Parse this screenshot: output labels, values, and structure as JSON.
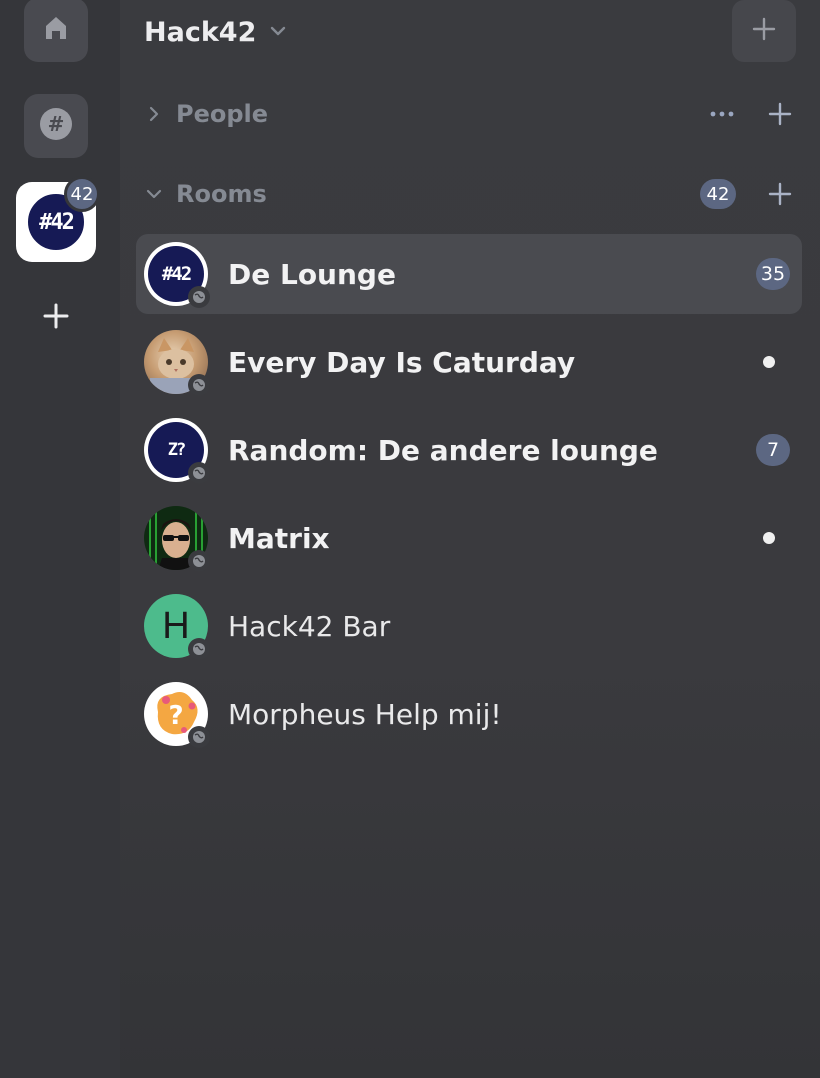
{
  "rail": {
    "home_icon": "home-icon",
    "explore_icon": "hash-icon",
    "active_space": {
      "name": "Hack42",
      "badge": "42",
      "avatar_text": "#42"
    },
    "add_icon": "plus-icon"
  },
  "header": {
    "space_name": "Hack42",
    "chevron": "chevron-down-icon",
    "add_icon": "plus-icon"
  },
  "sections": {
    "people": {
      "label": "People",
      "expanded": false
    },
    "rooms": {
      "label": "Rooms",
      "expanded": true,
      "badge": "42"
    }
  },
  "rooms": [
    {
      "name": "De Lounge",
      "unread": "35",
      "indicator": "count",
      "bold": true,
      "selected": true,
      "avatar": "hack42-logo"
    },
    {
      "name": "Every Day Is Caturday",
      "unread": "",
      "indicator": "dot",
      "bold": true,
      "selected": false,
      "avatar": "cat-photo"
    },
    {
      "name": "Random: De andere lounge",
      "unread": "7",
      "indicator": "count",
      "bold": true,
      "selected": false,
      "avatar": "hack42-logo-alt"
    },
    {
      "name": "Matrix",
      "unread": "",
      "indicator": "dot",
      "bold": true,
      "selected": false,
      "avatar": "matrix-photo"
    },
    {
      "name": "Hack42 Bar",
      "unread": "",
      "indicator": "none",
      "bold": false,
      "selected": false,
      "avatar": "letter",
      "avatar_letter": "H"
    },
    {
      "name": "Morpheus Help mij!",
      "unread": "",
      "indicator": "none",
      "bold": false,
      "selected": false,
      "avatar": "question-logo"
    }
  ],
  "colors": {
    "accent_badge": "#5c6782",
    "selected_row": "#4a4b50",
    "bar_avatar": "#4dbb8c"
  }
}
